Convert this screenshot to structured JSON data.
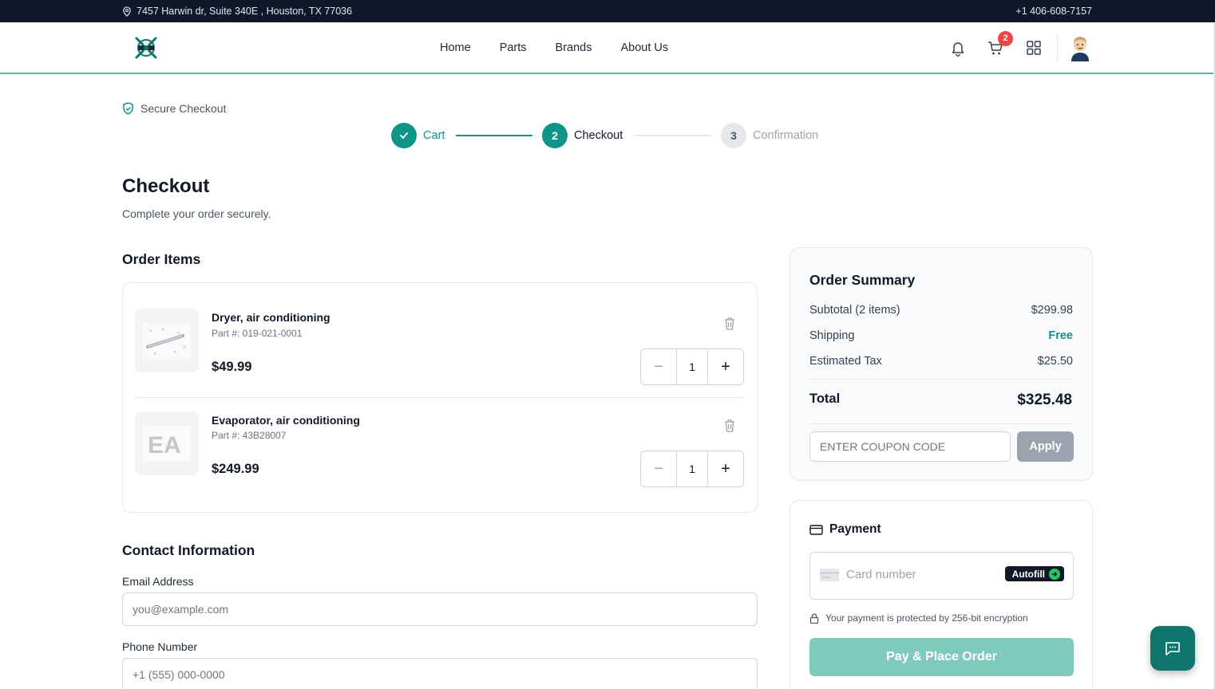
{
  "topbar": {
    "address": "7457 Harwin dr, Suite 340E , Houston, TX 77036",
    "phone": "+1 406-608-7157",
    "icon": "location-pin-icon"
  },
  "nav": {
    "links": [
      "Home",
      "Parts",
      "Brands",
      "About Us"
    ],
    "cart_count": "2",
    "icons": [
      "bell-icon",
      "cart-icon",
      "grid-icon",
      "avatar"
    ]
  },
  "steps": {
    "secure_label": "Secure Checkout",
    "items": [
      {
        "label": "Cart",
        "number": "✓",
        "state": "done"
      },
      {
        "label": "Checkout",
        "number": "2",
        "state": "active"
      },
      {
        "label": "Confirmation",
        "number": "3",
        "state": "pending"
      }
    ]
  },
  "page": {
    "title": "Checkout",
    "subtitle": "Complete your order securely."
  },
  "order_items": {
    "heading": "Order Items",
    "items": [
      {
        "name": "Dryer, air conditioning",
        "part": "Part #: 019-021-0001",
        "price": "$49.99",
        "qty": "1"
      },
      {
        "name": "Evaporator, air conditioning",
        "part": "Part #: 43B28007",
        "price": "$249.99",
        "qty": "1"
      }
    ]
  },
  "contact": {
    "heading": "Contact Information",
    "email_label": "Email Address",
    "email_placeholder": "you@example.com",
    "phone_label": "Phone Number",
    "phone_placeholder": "+1 (555) 000-0000"
  },
  "summary": {
    "title": "Order Summary",
    "subtotal_label": "Subtotal (2 items)",
    "subtotal": "$299.98",
    "shipping_label": "Shipping",
    "shipping": "Free",
    "tax_label": "Estimated Tax",
    "tax": "$25.50",
    "total_label": "Total",
    "total": "$325.48",
    "coupon_placeholder": "ENTER COUPON CODE",
    "apply_label": "Apply"
  },
  "payment": {
    "title": "Payment",
    "card_placeholder": "Card number",
    "autofill_label": "Autofill",
    "secure_note": "Your payment is protected by 256-bit encryption",
    "pay_label": "Pay & Place Order"
  },
  "colors": {
    "accent": "#0f9488",
    "dark": "#0f172a",
    "pay_button": "#7fcabd",
    "badge": "#ef4444"
  }
}
